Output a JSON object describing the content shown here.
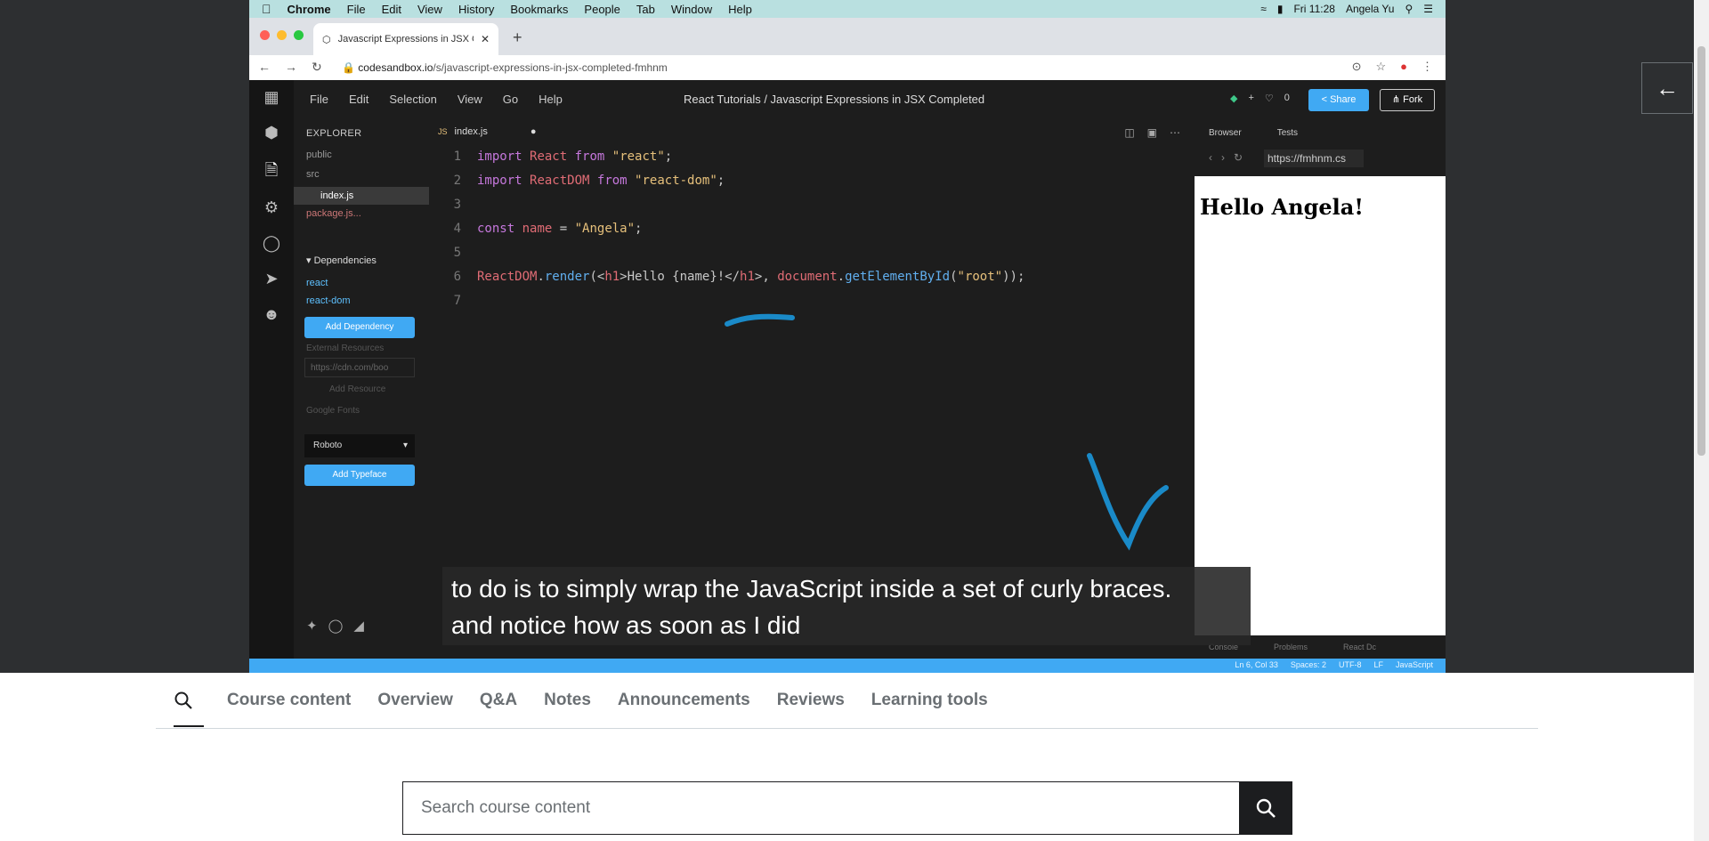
{
  "mac_menu": {
    "app": "Chrome",
    "items": [
      "File",
      "Edit",
      "View",
      "History",
      "Bookmarks",
      "People",
      "Tab",
      "Window",
      "Help"
    ],
    "clock": "Fri 11:28",
    "user": "Angela Yu"
  },
  "browser": {
    "tab_title": "Javascript Expressions in JSX C...",
    "url_host": "codesandbox.io",
    "url_path": "/s/javascript-expressions-in-jsx-completed-fmhnm"
  },
  "ide": {
    "menu": [
      "File",
      "Edit",
      "Selection",
      "View",
      "Go",
      "Help"
    ],
    "title": "React Tutorials / Javascript Expressions in JSX Completed",
    "likes": "0",
    "share_label": "Share",
    "fork_label": "Fork",
    "explorer_title": "EXPLORER",
    "tree": [
      "public",
      "src",
      "index.js",
      "package.js..."
    ],
    "dependencies_label": "Dependencies",
    "dependencies": [
      "react",
      "react-dom"
    ],
    "add_dependency": "Add Dependency",
    "external_resources": "External Resources",
    "external_placeholder": "https://cdn.com/boo",
    "add_resource": "Add Resource",
    "google_fonts": "Google Fonts",
    "font_select": "Roboto",
    "add_typeface": "Add Typeface",
    "file_tab": "index.js",
    "line_numbers": [
      "1",
      "2",
      "3",
      "4",
      "5",
      "6",
      "7"
    ]
  },
  "preview": {
    "tabs": [
      "Browser",
      "Tests"
    ],
    "url": "https://fmhnm.cs",
    "heading": "Hello Angela!",
    "footer": [
      "Console",
      "Problems",
      "React Dc"
    ]
  },
  "status": {
    "position": "Ln 6, Col 33",
    "spaces": "Spaces: 2",
    "encoding": "UTF-8",
    "eol": "LF",
    "lang": "JavaScript"
  },
  "caption": {
    "line1": "to do is to simply wrap the JavaScript inside a set of curly braces.",
    "line2": "and notice how as soon as I did"
  },
  "course_tabs": [
    "Course content",
    "Overview",
    "Q&A",
    "Notes",
    "Announcements",
    "Reviews",
    "Learning tools"
  ],
  "search": {
    "placeholder": "Search course content"
  }
}
